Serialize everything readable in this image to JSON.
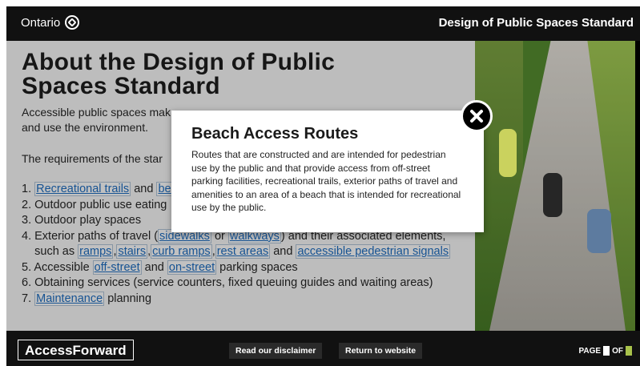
{
  "header": {
    "brand": "Ontario",
    "title": "Design of Public Spaces Standard"
  },
  "slide": {
    "heading": "About the Design of Public Spaces Standard",
    "intro_visible_a": "Accessible public spaces mak",
    "intro_visible_b": "and use the environment.",
    "requirements_visible": "The requirements of the star",
    "list": {
      "item1_num": "1.",
      "item1_link": "Recreational trails",
      "item1_and": "and",
      "item1_link2": "be",
      "item2": "2. Outdoor public use eating",
      "item3": "3. Outdoor play spaces",
      "item4_a": "4. Exterior paths of travel (",
      "item4_link1": "sidewalks",
      "item4_or": "or",
      "item4_link2": "walkways",
      "item4_b": ") and their associated elements,",
      "item4_c": "such as",
      "item4_link3": "ramps",
      "item4_link4": "stairs",
      "item4_link5": "curb ramps",
      "item4_link6": "rest areas",
      "item4_and": "and",
      "item4_link7": "accessible pedestrian signals",
      "item5_a": "5. Accessible",
      "item5_link1": "off-street",
      "item5_and": "and",
      "item5_link2": "on-street",
      "item5_b": "parking spaces",
      "item6": "6. Obtaining services (service counters, fixed queuing guides and waiting areas)",
      "item7_num": "7.",
      "item7_link": "Maintenance",
      "item7_b": "planning"
    }
  },
  "popup": {
    "title": "Beach Access Routes",
    "text": "Routes that are constructed and are intended for pedestrian use by the public and that provide access from off-street parking facilities, recreational trails, exterior paths of travel and amenities to an area of a beach that is intended for recreational use by the public.",
    "close_icon": "close-icon"
  },
  "footer": {
    "brand": "AccessForward",
    "disclaimer": "Read our disclaimer",
    "return": "Return to website",
    "page_label": "PAGE",
    "of_label": "OF",
    "page_current": "",
    "page_total": ""
  },
  "colors": {
    "link": "#1a5fa8",
    "bar": "#111111",
    "page_total_badge": "#a8c24b"
  }
}
